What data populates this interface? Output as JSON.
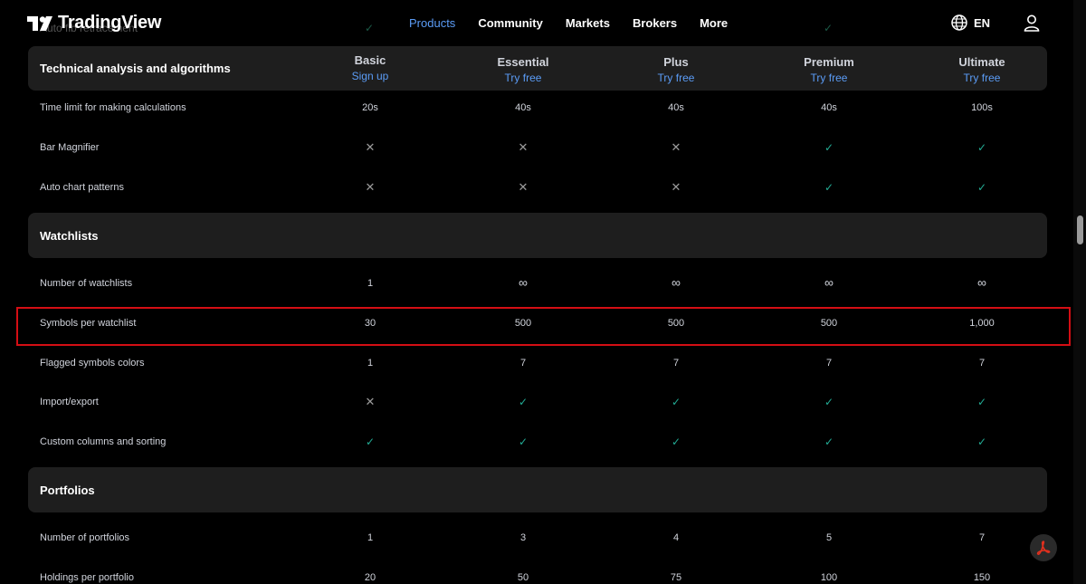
{
  "nav": {
    "logo_text": "TradingView",
    "links": [
      {
        "label": "Products",
        "active": true
      },
      {
        "label": "Community",
        "active": false
      },
      {
        "label": "Markets",
        "active": false
      },
      {
        "label": "Brokers",
        "active": false
      },
      {
        "label": "More",
        "active": false
      }
    ],
    "language": "EN"
  },
  "ghost_row_label": "Auto fib retracement",
  "plans": [
    {
      "name": "Basic",
      "cta": "Sign up"
    },
    {
      "name": "Essential",
      "cta": "Try free"
    },
    {
      "name": "Plus",
      "cta": "Try free"
    },
    {
      "name": "Premium",
      "cta": "Try free"
    },
    {
      "name": "Ultimate",
      "cta": "Try free"
    }
  ],
  "sections": {
    "technical": {
      "title": "Technical analysis and algorithms",
      "rows": [
        {
          "label": "Time limit for making calculations",
          "values": [
            "20s",
            "40s",
            "40s",
            "40s",
            "100s"
          ]
        },
        {
          "label": "Bar Magnifier",
          "values": [
            "✕",
            "✕",
            "✕",
            "✓",
            "✓"
          ]
        },
        {
          "label": "Auto chart patterns",
          "values": [
            "✕",
            "✕",
            "✕",
            "✓",
            "✓"
          ]
        }
      ]
    },
    "watchlists": {
      "title": "Watchlists",
      "rows": [
        {
          "label": "Number of watchlists",
          "values": [
            "1",
            "∞",
            "∞",
            "∞",
            "∞"
          ]
        },
        {
          "label": "Symbols per watchlist",
          "values": [
            "30",
            "500",
            "500",
            "500",
            "1,000"
          ]
        },
        {
          "label": "Flagged symbols colors",
          "values": [
            "1",
            "7",
            "7",
            "7",
            "7"
          ]
        },
        {
          "label": "Import/export",
          "values": [
            "✕",
            "✓",
            "✓",
            "✓",
            "✓"
          ]
        },
        {
          "label": "Custom columns and sorting",
          "values": [
            "✓",
            "✓",
            "✓",
            "✓",
            "✓"
          ]
        }
      ]
    },
    "portfolios": {
      "title": "Portfolios",
      "rows": [
        {
          "label": "Number of portfolios",
          "values": [
            "1",
            "3",
            "4",
            "5",
            "7"
          ]
        },
        {
          "label": "Holdings per portfolio",
          "values": [
            "20",
            "50",
            "75",
            "100",
            "150"
          ]
        }
      ]
    }
  },
  "colors": {
    "accent_blue": "#5b9cf6",
    "check_green": "#22ab94",
    "highlight_red": "#d40e14",
    "section_bg": "#1e1e1e"
  }
}
